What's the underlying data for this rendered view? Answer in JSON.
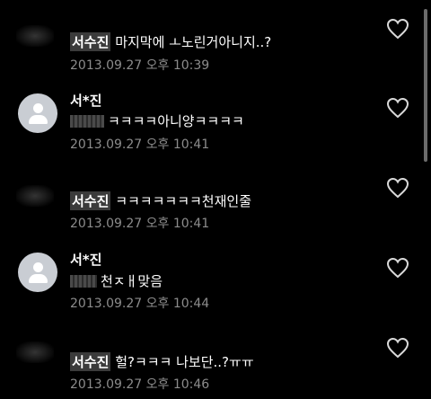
{
  "comments": [
    {
      "author": "서수진",
      "text": "마지막에 ㅗ노린거아니지..?",
      "time": "2013.09.27 오후 10:39",
      "avatar": "blurred"
    },
    {
      "author": "서*진",
      "text": "ㅋㅋㅋㅋ아니양ㅋㅋㅋㅋ",
      "time": "2013.09.27 오후 10:41",
      "avatar": "default-profile"
    },
    {
      "author": "서수진",
      "text": "ㅋㅋㅋㅋㅋㅋㅋ천재인줄",
      "time": "2013.09.27 오후 10:41",
      "avatar": "blurred"
    },
    {
      "author": "서*진",
      "text": "천ㅈㅐ맞음",
      "time": "2013.09.27 오후 10:44",
      "avatar": "default-profile"
    },
    {
      "author": "서수진",
      "text": "헐?ㅋㅋㅋ 나보단..?ㅠㅠ",
      "time": "2013.09.27 오후 10:46",
      "avatar": "blurred"
    }
  ],
  "icons": {
    "like": "heart-outline-icon",
    "profile": "user-silhouette-icon"
  },
  "colors": {
    "background": "#000000",
    "timestamp": "#8c8c8c",
    "avatar_bg": "#c9cdd3",
    "name_chip": "#3b3b3b"
  }
}
